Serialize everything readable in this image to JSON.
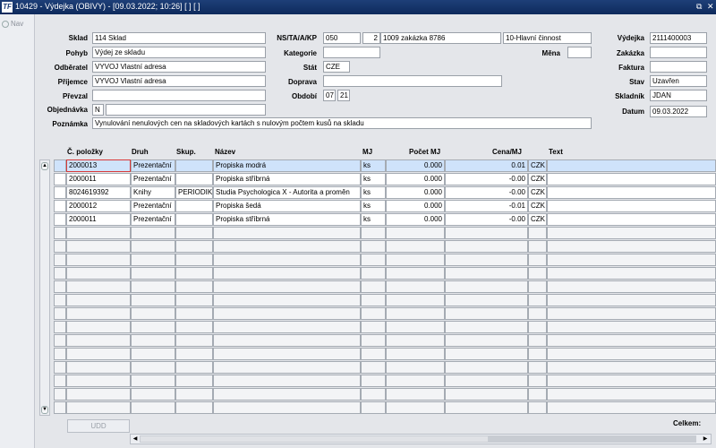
{
  "window": {
    "title": "10429 - Výdejka (OBIVY) - [09.03.2022; 10:26]  [ ]  [ ]",
    "app_icon": "TF",
    "restore_icon": "⧉",
    "close_icon": "✕"
  },
  "sidebar": {
    "nav_label": "Nav"
  },
  "form": {
    "sklad_label": "Sklad",
    "sklad": "114 Sklad",
    "pohyb_label": "Pohyb",
    "pohyb": "Výdej ze skladu",
    "odberatel_label": "Odběratel",
    "odberatel": "VYVOJ Vlastní adresa",
    "prijemce_label": "Příjemce",
    "prijemce": "VYVOJ Vlastní adresa",
    "prevzal_label": "Převzal",
    "prevzal": "",
    "objednavka_label": "Objednávka",
    "objednavka_flag": "N",
    "objednavka": "",
    "poznamka_label": "Poznámka",
    "poznamka": "Vynulování nenulových cen na skladových kartách s nulovým počtem kusů na skladu",
    "ns_label": "NS/TA/A/KP",
    "ns": "050",
    "ta": "2",
    "a": "1009 zakázka 8786",
    "kp": "10-Hlavní činnost",
    "kategorie_label": "Kategorie",
    "kategorie": "",
    "mena_label": "Měna",
    "mena": "",
    "stat_label": "Stát",
    "stat": "CZE",
    "doprava_label": "Doprava",
    "doprava": "",
    "obdobi_label": "Období",
    "obdobi_m": "07",
    "obdobi_y": "21",
    "vydejka_label": "Výdejka",
    "vydejka": "2111400003",
    "zakazka_label": "Zakázka",
    "zakazka": "",
    "faktura_label": "Faktura",
    "faktura": "",
    "stav_label": "Stav",
    "stav": "Uzavřen",
    "skladnik_label": "Skladník",
    "skladnik": "JDAN",
    "datum_label": "Datum",
    "datum": "09.03.2022"
  },
  "grid": {
    "headers": {
      "cislo": "Č. položky",
      "druh": "Druh",
      "skup": "Skup.",
      "nazev": "Název",
      "mj": "MJ",
      "pocet": "Počet MJ",
      "cena": "Cena/MJ",
      "text": "Text"
    },
    "rows": [
      {
        "cislo": "2000013",
        "druh": "Prezentační",
        "skup": "",
        "nazev": "Propiska modrá",
        "mj": "ks",
        "pocet": "0.000",
        "cena": "0.01",
        "mena": "CZK"
      },
      {
        "cislo": "2000011",
        "druh": "Prezentační",
        "skup": "",
        "nazev": "Propiska stříbrná",
        "mj": "ks",
        "pocet": "0.000",
        "cena": "-0.00",
        "mena": "CZK"
      },
      {
        "cislo": "8024619392",
        "druh": "Knihy",
        "skup": "PERIODIKU",
        "nazev": "Studia Psychologica X - Autorita a proměn",
        "mj": "ks",
        "pocet": "0.000",
        "cena": "-0.00",
        "mena": "CZK"
      },
      {
        "cislo": "2000012",
        "druh": "Prezentační",
        "skup": "",
        "nazev": "Propiska šedá",
        "mj": "ks",
        "pocet": "0.000",
        "cena": "-0.01",
        "mena": "CZK"
      },
      {
        "cislo": "2000011",
        "druh": "Prezentační",
        "skup": "",
        "nazev": "Propiska stříbrná",
        "mj": "ks",
        "pocet": "0.000",
        "cena": "-0.00",
        "mena": "CZK"
      }
    ],
    "empty_rows": 14
  },
  "footer": {
    "udd_label": "UDD",
    "celkem_label": "Celkem:"
  },
  "colors": {
    "selected_row": "#cfe3fb",
    "active_cell_border": "#d83a3a"
  }
}
